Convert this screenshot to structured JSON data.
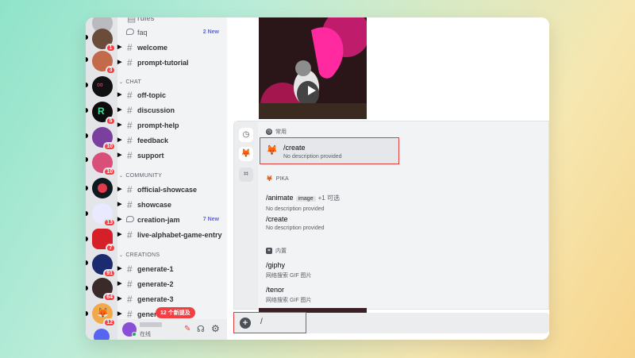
{
  "rail": {
    "servers": [
      {
        "badge": "1",
        "color": "#6b4c3a"
      },
      {
        "badge": "3",
        "color": "#c26a4a"
      },
      {
        "badge": "",
        "color": "#111111"
      },
      {
        "badge": "5",
        "color": "#0d0d0d"
      },
      {
        "badge": "10",
        "color": "#7b3fa0"
      },
      {
        "badge": "10",
        "color": "#d94f7a"
      },
      {
        "badge": "",
        "color": "#0e1a1f"
      },
      {
        "badge": "13",
        "color": "#e9e9ff"
      },
      {
        "badge": "7",
        "color": "#d5202a"
      },
      {
        "badge": "91",
        "color": "#1c2b6f"
      },
      {
        "badge": "64",
        "color": "#3a2a2a"
      },
      {
        "badge": "12",
        "color": "#f1a94a"
      }
    ]
  },
  "channels": {
    "top": [
      {
        "label": "faq",
        "kind": "forum",
        "new": "2 New"
      },
      {
        "label": "welcome",
        "kind": "text"
      },
      {
        "label": "prompt-tutorial",
        "kind": "text"
      }
    ],
    "chat_category": "CHAT",
    "chat": [
      "off-topic",
      "discussion",
      "prompt-help",
      "feedback",
      "support"
    ],
    "community_category": "COMMUNITY",
    "community": [
      {
        "label": "official-showcase",
        "kind": "text"
      },
      {
        "label": "showcase",
        "kind": "text"
      },
      {
        "label": "creation-jam",
        "kind": "forum",
        "new": "7 New"
      },
      {
        "label": "live-alphabet-game-entry",
        "kind": "text"
      }
    ],
    "creations_category": "CREATIONS",
    "creations": [
      "generate-1",
      "generate-2",
      "generate-3",
      "gener"
    ],
    "new_messages_pill": "12 个新提及"
  },
  "user": {
    "status": "在线"
  },
  "popup": {
    "sections": {
      "frequent": "常用",
      "pika": "PIKA",
      "builtin": "内置"
    },
    "frequent_command": {
      "name": "/create",
      "desc": "No description provided"
    },
    "pika_commands": [
      {
        "name": "/animate",
        "option": "image",
        "more": "+1 可选",
        "desc": "No description provided"
      },
      {
        "name": "/create",
        "desc": "No description provided"
      }
    ],
    "builtin_commands": [
      {
        "name": "/giphy",
        "desc": "网络搜索 GIF 图片"
      },
      {
        "name": "/tenor",
        "desc": "网络搜索 GIF 图片"
      }
    ]
  },
  "chat": {
    "input_value": "/"
  },
  "colors": {
    "accent": "#5865f2",
    "alert": "#f23f43",
    "highlight_border": "#e03c3c"
  }
}
